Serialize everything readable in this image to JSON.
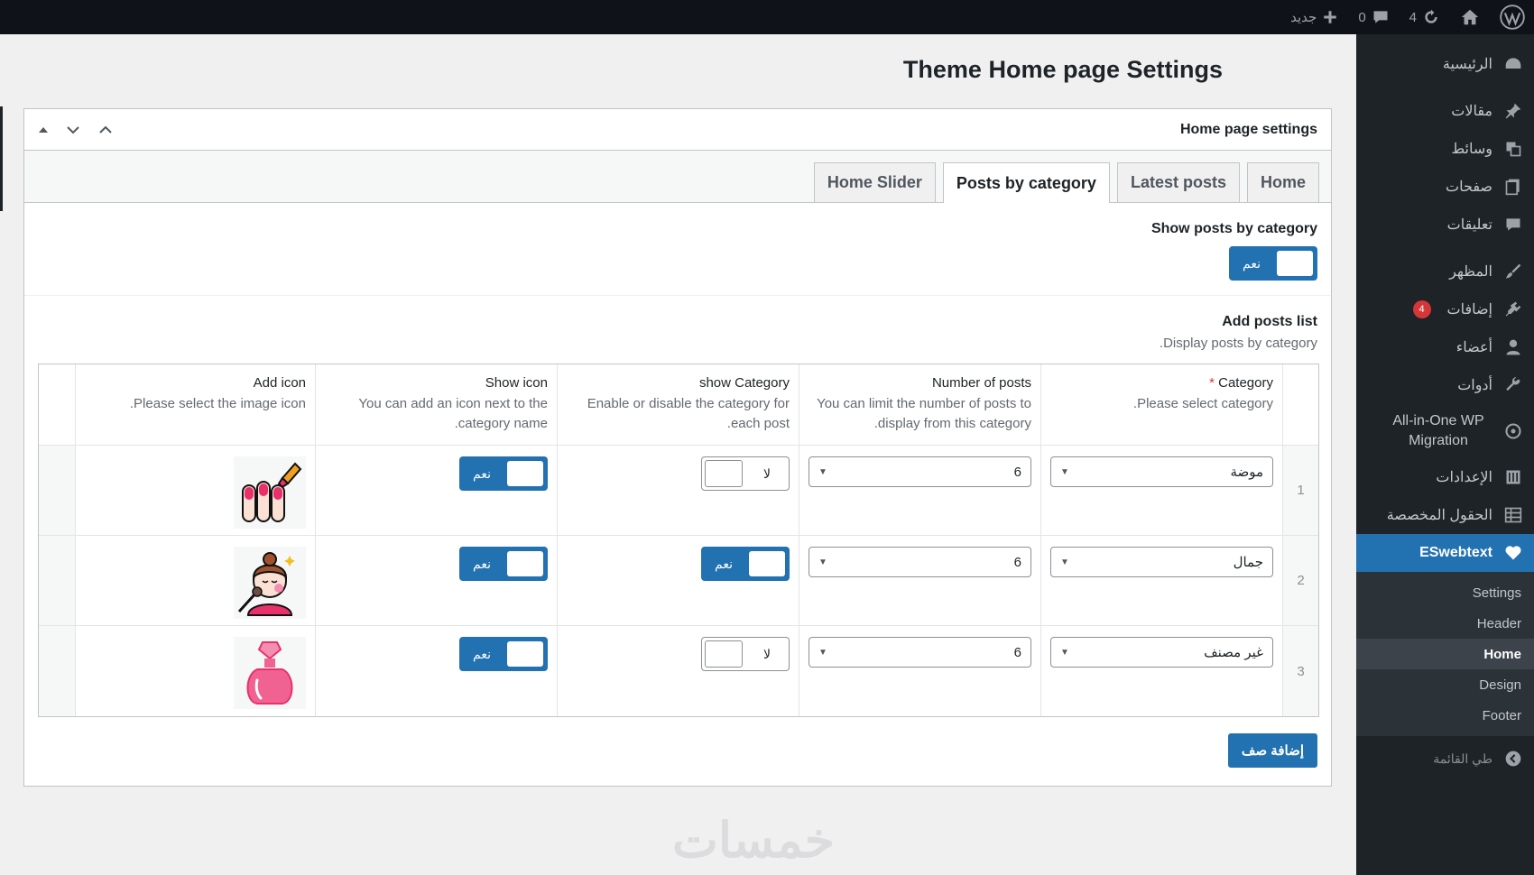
{
  "adminbar": {
    "new_label": "جديد",
    "comments_count": "0",
    "updates_count": "4"
  },
  "sidebar": {
    "items": [
      {
        "label": "الرئيسية",
        "icon": "dashboard-icon"
      },
      {
        "label": "مقالات",
        "icon": "pin-icon"
      },
      {
        "label": "وسائط",
        "icon": "media-icon"
      },
      {
        "label": "صفحات",
        "icon": "pages-icon"
      },
      {
        "label": "تعليقات",
        "icon": "comments-icon"
      },
      {
        "label": "المظهر",
        "icon": "brush-icon"
      },
      {
        "label": "إضافات",
        "icon": "plugins-icon",
        "badge": "4"
      },
      {
        "label": "أعضاء",
        "icon": "users-icon"
      },
      {
        "label": "أدوات",
        "icon": "tools-icon"
      },
      {
        "label": "All-in-One WP Migration",
        "icon": "migration-icon"
      },
      {
        "label": "الإعدادات",
        "icon": "settings-icon"
      },
      {
        "label": "الحقول المخصصة",
        "icon": "fields-icon"
      }
    ],
    "current": {
      "label": "ESwebtext",
      "icon": "heart-icon"
    },
    "submenu": [
      "Settings",
      "Header",
      "Home",
      "Design",
      "Footer"
    ],
    "collapse_label": "طي القائمة"
  },
  "page": {
    "title": "Theme Home page Settings"
  },
  "postbox": {
    "title": "Home page settings",
    "tabs": [
      "Home",
      "Latest posts",
      "Posts by category",
      "Home Slider"
    ],
    "active_tab": "Posts by category",
    "show_posts": {
      "label": "Show posts by category",
      "toggle_on": "نعم"
    },
    "posts_list": {
      "label": "Add posts list",
      "description": "Display posts by category."
    },
    "columns": [
      {
        "title": "Category",
        "required": "*",
        "desc": "Please select category."
      },
      {
        "title": "Number of posts",
        "desc": "You can limit the number of posts to display from this category."
      },
      {
        "title": "show Category",
        "desc": "Enable or disable the category for each post."
      },
      {
        "title": "Show icon",
        "desc": "You can add an icon next to the category name."
      },
      {
        "title": "Add icon",
        "desc": "Please select the image icon."
      }
    ],
    "rows": [
      {
        "num": "1",
        "category": "موضة",
        "count": "6",
        "show_category": "لا",
        "show_icon": "نعم",
        "icon": "nails-icon"
      },
      {
        "num": "2",
        "category": "جمال",
        "count": "6",
        "show_category": "نعم",
        "show_icon": "نعم",
        "icon": "makeup-icon"
      },
      {
        "num": "3",
        "category": "غير مصنف",
        "count": "6",
        "show_category": "لا",
        "show_icon": "نعم",
        "icon": "perfume-icon"
      }
    ],
    "add_row_label": "إضافة صف"
  },
  "watermark": "خمسات"
}
